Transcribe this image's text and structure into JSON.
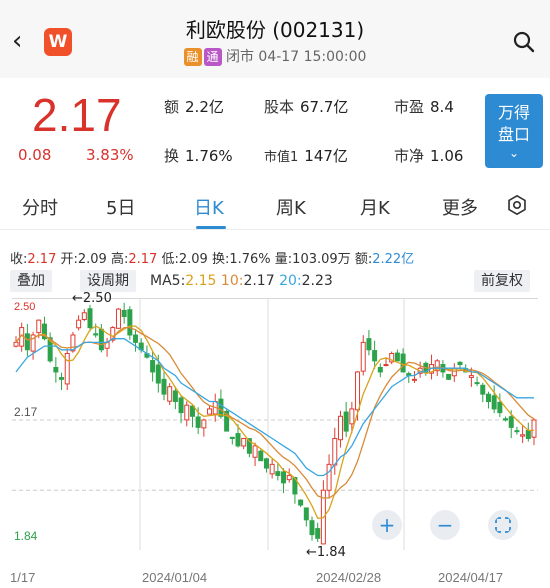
{
  "header": {
    "title": "利欧股份 (002131)",
    "tag_rong": "融",
    "tag_tong": "通",
    "status": "闭市 04-17 15:00:00",
    "logo_letter": "W"
  },
  "quote": {
    "last": "2.17",
    "change": "0.08",
    "change_pct": "3.83%",
    "items": [
      {
        "k": "额",
        "v": "2.2亿"
      },
      {
        "k": "股本",
        "v": "67.7亿"
      },
      {
        "k": "市盈",
        "v": "8.4"
      },
      {
        "k": "换",
        "v": "1.76%"
      },
      {
        "k": "市值1",
        "v": "147亿"
      },
      {
        "k": "市净",
        "v": "1.06"
      }
    ],
    "side_button": {
      "line1": "万得",
      "line2": "盘口",
      "chevron": "⌄"
    }
  },
  "tabs": [
    "分时",
    "5日",
    "日K",
    "周K",
    "月K",
    "更多"
  ],
  "active_tab": "日K",
  "ohlc_line": {
    "close_label": "收:",
    "close": "2.17",
    "open_label": "开:",
    "open": "2.09",
    "high_label": "高:",
    "high": "2.17",
    "low_label": "低:",
    "low": "2.09",
    "turnover_label": "换:",
    "turnover": "1.76%",
    "volume_label": "量:",
    "volume": "103.09万",
    "amount_label": "额:",
    "amount": "2.22亿"
  },
  "toolbar": {
    "overlay": "叠加",
    "period": "设周期",
    "ma5_label": "MA5:",
    "ma5": "2.15",
    "ma10_label": "10:",
    "ma10": "2.17",
    "ma20_label": "20:",
    "ma20": "2.23",
    "adjust": "前复权"
  },
  "chart_data": {
    "type": "candlestick",
    "y_axis_labels": [
      "2.50",
      "2.17",
      "1.84"
    ],
    "ylim": [
      1.84,
      2.5
    ],
    "x_tick_labels": [
      "1/17",
      "2024/01/04",
      "2024/02/28",
      "2024/04/17"
    ],
    "annotations": [
      {
        "text": "←2.50",
        "value": 2.5
      },
      {
        "text": "←1.84",
        "value": 1.84
      }
    ],
    "ma_colors": {
      "ma5": "#d9a21b",
      "ma10": "#d88a37",
      "ma20": "#3aa6e0"
    },
    "up_color": "#e03c31",
    "down_color": "#2ca34a",
    "grid": true,
    "close_series_approx": [
      2.38,
      2.42,
      2.36,
      2.4,
      2.44,
      2.39,
      2.33,
      2.3,
      2.28,
      2.35,
      2.4,
      2.44,
      2.46,
      2.42,
      2.4,
      2.36,
      2.38,
      2.42,
      2.47,
      2.45,
      2.4,
      2.38,
      2.36,
      2.34,
      2.3,
      2.27,
      2.24,
      2.26,
      2.22,
      2.19,
      2.21,
      2.18,
      2.15,
      2.17,
      2.2,
      2.22,
      2.18,
      2.14,
      2.12,
      2.1,
      2.12,
      2.08,
      2.1,
      2.06,
      2.04,
      2.05,
      2.02,
      2.0,
      2.02,
      1.97,
      1.94,
      1.9,
      1.86,
      1.85,
      1.98,
      2.05,
      2.12,
      2.18,
      2.14,
      2.2,
      2.3,
      2.38,
      2.36,
      2.33,
      2.3,
      2.32,
      2.35,
      2.33,
      2.3,
      2.29,
      2.28,
      2.31,
      2.3,
      2.32,
      2.33,
      2.3,
      2.28,
      2.31,
      2.32,
      2.3,
      2.29,
      2.27,
      2.24,
      2.22,
      2.2,
      2.19,
      2.17,
      2.15,
      2.14,
      2.13,
      2.12,
      2.17
    ],
    "ma_series": {
      "ma20": [
        2.3,
        2.32,
        2.34,
        2.35,
        2.36,
        2.37,
        2.37,
        2.37,
        2.36,
        2.36,
        2.36,
        2.37,
        2.38,
        2.38,
        2.38,
        2.38,
        2.38,
        2.39,
        2.39,
        2.39,
        2.38,
        2.37,
        2.36,
        2.35,
        2.34,
        2.33,
        2.31,
        2.3,
        2.29,
        2.27,
        2.26,
        2.25,
        2.24,
        2.23,
        2.22,
        2.22,
        2.21,
        2.2,
        2.19,
        2.18,
        2.17,
        2.16,
        2.15,
        2.14,
        2.13,
        2.12,
        2.11,
        2.1,
        2.09,
        2.08,
        2.06,
        2.04,
        2.03,
        2.02,
        2.02,
        2.03,
        2.05,
        2.07,
        2.08,
        2.1,
        2.13,
        2.16,
        2.18,
        2.2,
        2.22,
        2.24,
        2.26,
        2.27,
        2.28,
        2.29,
        2.29,
        2.3,
        2.3,
        2.31,
        2.31,
        2.31,
        2.31,
        2.31,
        2.31,
        2.31,
        2.3,
        2.3,
        2.29,
        2.28,
        2.27,
        2.26,
        2.25,
        2.24,
        2.23,
        2.23,
        2.23,
        2.23
      ]
    }
  },
  "zoom_controls": {
    "plus": "+",
    "minus": "−"
  },
  "icons": [
    "back-icon",
    "wind-logo-icon",
    "search-icon",
    "settings-icon",
    "zoom-in-icon",
    "zoom-out-icon",
    "fullscreen-icon"
  ]
}
